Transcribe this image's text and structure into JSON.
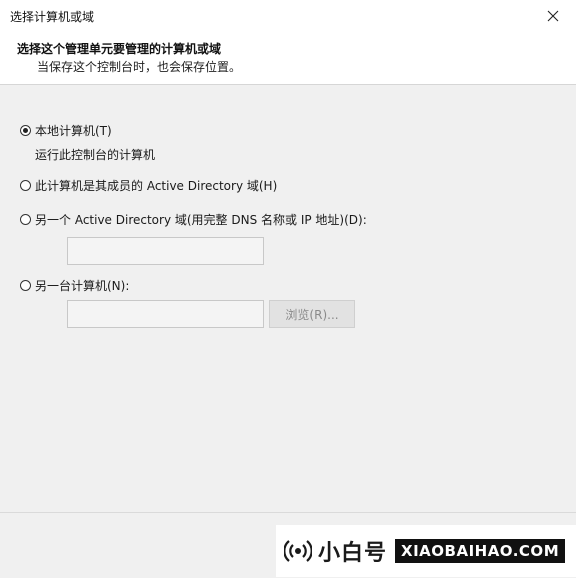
{
  "window": {
    "title": "选择计算机或域"
  },
  "header": {
    "title": "选择这个管理单元要管理的计算机或域",
    "subtitle": "当保存这个控制台时，也会保存位置。"
  },
  "options": {
    "local": {
      "label": "本地计算机(T)",
      "description": "运行此控制台的计算机",
      "checked": true
    },
    "domain_member": {
      "label": "此计算机是其成员的 Active Directory 域(H)",
      "checked": false
    },
    "other_domain": {
      "label": "另一个 Active Directory 域(用完整 DNS 名称或 IP 地址)(D):",
      "value": "",
      "checked": false
    },
    "other_computer": {
      "label": "另一台计算机(N):",
      "value": "",
      "checked": false
    }
  },
  "browse_button": {
    "label": "浏览(R)..."
  },
  "watermark": {
    "brand_cn": "小白号",
    "brand_en": "XIAOBAIHAO.COM"
  },
  "icons": [
    "close-icon",
    "radio-icon",
    "broadcast-icon"
  ],
  "colors": {
    "background": "#f0f0f0",
    "header_bg": "#ffffff",
    "disabled_text": "#8a8a8a"
  }
}
